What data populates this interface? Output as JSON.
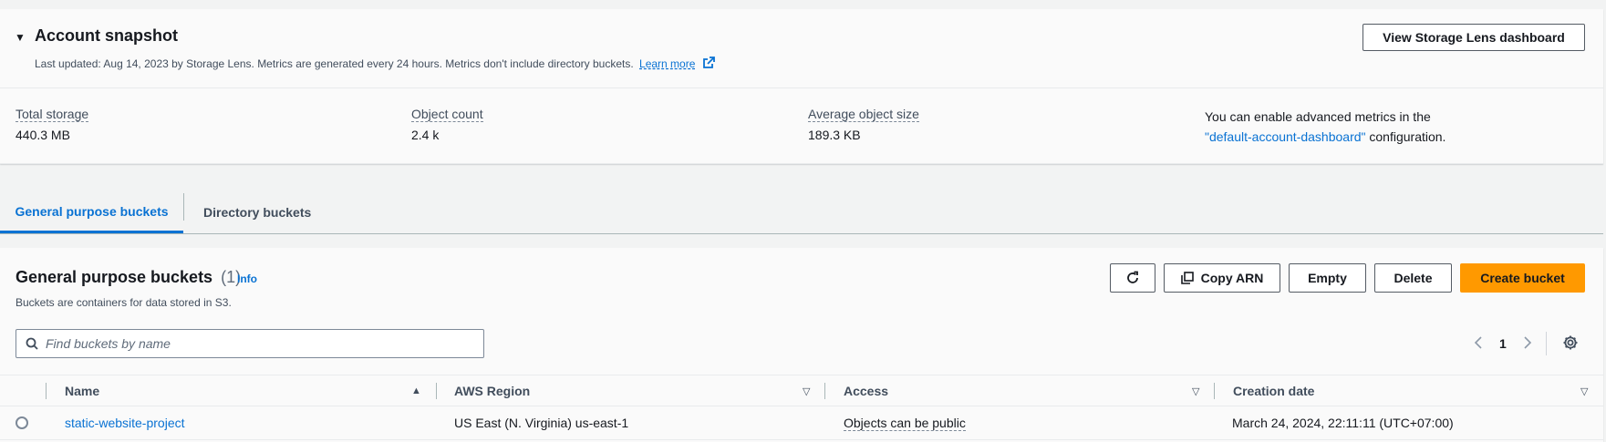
{
  "snapshot": {
    "title": "Account snapshot",
    "description": "Last updated: Aug 14, 2023 by Storage Lens. Metrics are generated every 24 hours. Metrics don't include directory buckets.",
    "learn_more": "Learn more",
    "lens_button": "View Storage Lens dashboard",
    "metrics": [
      {
        "label": "Total storage",
        "value": "440.3 MB"
      },
      {
        "label": "Object count",
        "value": "2.4 k"
      },
      {
        "label": "Average object size",
        "value": "189.3 KB"
      }
    ],
    "advanced_prefix": "You can enable advanced metrics in the",
    "advanced_link": "\"default-account-dashboard\"",
    "advanced_suffix": "configuration."
  },
  "tabs": [
    {
      "label": "General purpose buckets",
      "active": true
    },
    {
      "label": "Directory buckets",
      "active": false
    }
  ],
  "buckets": {
    "title": "General purpose buckets",
    "count": "(1)",
    "info": "Info",
    "description": "Buckets are containers for data stored in S3.",
    "buttons": {
      "copy_arn": "Copy ARN",
      "empty": "Empty",
      "delete": "Delete",
      "create": "Create bucket"
    },
    "search_placeholder": "Find buckets by name",
    "page": "1",
    "columns": [
      "Name",
      "AWS Region",
      "Access",
      "Creation date"
    ],
    "rows": [
      {
        "name": "static-website-project",
        "region": "US East (N. Virginia) us-east-1",
        "access": "Objects can be public",
        "created": "March 24, 2024, 22:11:11 (UTC+07:00)"
      }
    ]
  },
  "colors": {
    "link": "#0972d3",
    "primary_button": "#ff9900",
    "text": "#16191f"
  }
}
